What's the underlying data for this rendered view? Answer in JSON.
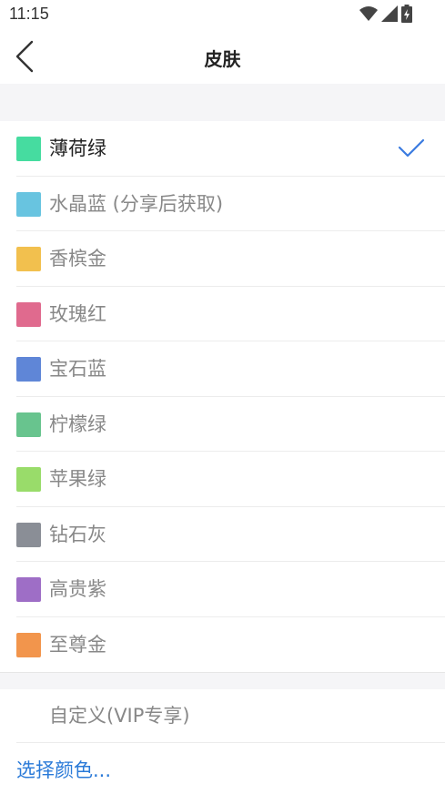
{
  "status_bar": {
    "time": "11:15",
    "icons": [
      "wifi-icon",
      "signal-icon",
      "battery-charging-icon"
    ]
  },
  "app_bar": {
    "title": "皮肤",
    "back_icon": "back-arrow-icon"
  },
  "accent_color": "#3a7be0",
  "skins": [
    {
      "label": "薄荷绿",
      "color": "#46dca0",
      "selected": true
    },
    {
      "label": "水晶蓝 (分享后获取)",
      "color": "#68c4e0",
      "selected": false
    },
    {
      "label": "香槟金",
      "color": "#f2c04e",
      "selected": false
    },
    {
      "label": "玫瑰红",
      "color": "#e06a8e",
      "selected": false
    },
    {
      "label": "宝石蓝",
      "color": "#5f86d7",
      "selected": false
    },
    {
      "label": "柠檬绿",
      "color": "#68c48e",
      "selected": false
    },
    {
      "label": "苹果绿",
      "color": "#99dc6a",
      "selected": false
    },
    {
      "label": "钻石灰",
      "color": "#8a8e96",
      "selected": false
    },
    {
      "label": "高贵紫",
      "color": "#9e6ec6",
      "selected": false
    },
    {
      "label": "至尊金",
      "color": "#f2954c",
      "selected": false
    }
  ],
  "custom": {
    "label": "自定义(VIP专享)"
  },
  "choose_color": {
    "label": "选择颜色..."
  }
}
